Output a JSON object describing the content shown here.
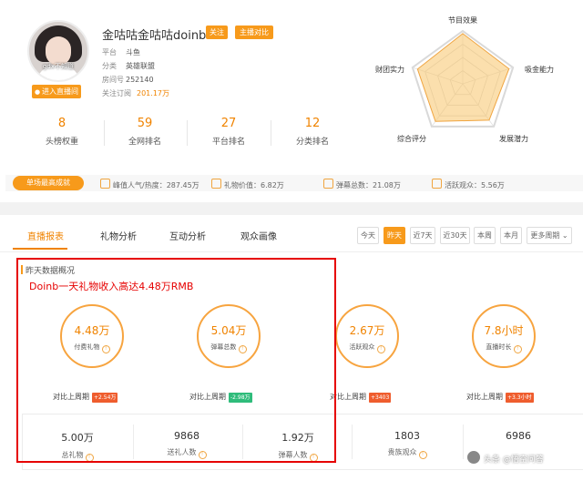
{
  "profile": {
    "name": "金咕咕金咕咕doinb",
    "follow_tag": "关注",
    "compare_tag": "主播对比",
    "avatar_caption": "gdx不知道",
    "enter_room": "进入直播间",
    "meta": [
      {
        "key": "平台",
        "value": "斗鱼"
      },
      {
        "key": "分类",
        "value": "英雄联盟"
      },
      {
        "key": "房间号",
        "value": "252140"
      },
      {
        "key": "关注订阅",
        "value": "201.17万"
      }
    ]
  },
  "ranks": [
    {
      "value": "8",
      "label": "头榜权重"
    },
    {
      "value": "59",
      "label": "全网排名"
    },
    {
      "value": "27",
      "label": "平台排名"
    },
    {
      "value": "12",
      "label": "分类排名"
    }
  ],
  "radar": {
    "labels": [
      "节目效果",
      "吸金能力",
      "发展潜力",
      "综合评分",
      "财团实力"
    ],
    "values": [
      0.95,
      0.92,
      0.85,
      0.88,
      0.9
    ]
  },
  "best": {
    "button": "单场最高成就",
    "items": [
      {
        "label": "峰值人气/热度：287.45万",
        "icon": "fire-icon"
      },
      {
        "label": "礼物价值：6.82万",
        "icon": "gift-icon"
      },
      {
        "label": "弹幕总数：21.08万",
        "icon": "danmaku-icon"
      },
      {
        "label": "活跃观众：5.56万",
        "icon": "audience-icon"
      }
    ]
  },
  "tabs": [
    "直播报表",
    "礼物分析",
    "互动分析",
    "观众画像"
  ],
  "periods": [
    "今天",
    "昨天",
    "近7天",
    "近30天",
    "本周",
    "本月",
    "更多周期"
  ],
  "section": {
    "title": "昨天数据概况",
    "headline": "Doinb一天礼物收入高达4.48万RMB"
  },
  "circles": [
    {
      "value": "4.48万",
      "label": "付费礼物",
      "compare": "对比上周期",
      "change": "+2.54万",
      "dir": "up"
    },
    {
      "value": "5.04万",
      "label": "弹幕总数",
      "compare": "对比上周期",
      "change": "-2.98万",
      "dir": "down"
    },
    {
      "value": "2.67万",
      "label": "活跃观众",
      "compare": "对比上周期",
      "change": "+3403",
      "dir": "up"
    },
    {
      "value": "7.8小时",
      "label": "直播时长",
      "compare": "对比上周期",
      "change": "+3.3小时",
      "dir": "up"
    }
  ],
  "bottom": [
    {
      "value": "5.00万",
      "label": "总礼物"
    },
    {
      "value": "9868",
      "label": "送礼人数"
    },
    {
      "value": "1.92万",
      "label": "弹幕人数"
    },
    {
      "value": "1803",
      "label": "贵族观众"
    },
    {
      "value": "6986",
      "label": ""
    }
  ],
  "watermark": "头条 @悟空问答",
  "colors": {
    "accent": "#f79a1b",
    "alert": "#e60000",
    "up": "#ef5d2e",
    "down": "#2fbc7b"
  }
}
